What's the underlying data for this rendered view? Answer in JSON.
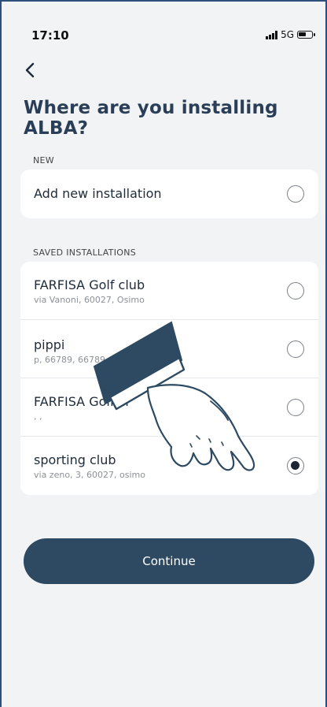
{
  "status_bar": {
    "time": "17:10",
    "network": "5G"
  },
  "header": {
    "title": "Where are you installing ALBA?"
  },
  "new_section": {
    "label": "NEW",
    "item": {
      "name": "Add new installation",
      "selected": false
    }
  },
  "saved_section": {
    "label": "SAVED INSTALLATIONS",
    "items": [
      {
        "name": "FARFISA Golf club",
        "address": "via Vanoni, 60027, Osimo",
        "selected": false
      },
      {
        "name": "pippi",
        "address": "p, 66789, 66789",
        "selected": false
      },
      {
        "name": "FARFISA Golf cl",
        "address": ", ,",
        "selected": false
      },
      {
        "name": "sporting club",
        "address": "via zeno, 3, 60027, osimo",
        "selected": true
      }
    ]
  },
  "continue_label": "Continue",
  "colors": {
    "accent": "#2d4a62",
    "title": "#2a3f57",
    "background": "#f2f3f5"
  },
  "icons": {
    "back": "chevron-left-icon",
    "overlay": "pointing-hand-icon"
  }
}
